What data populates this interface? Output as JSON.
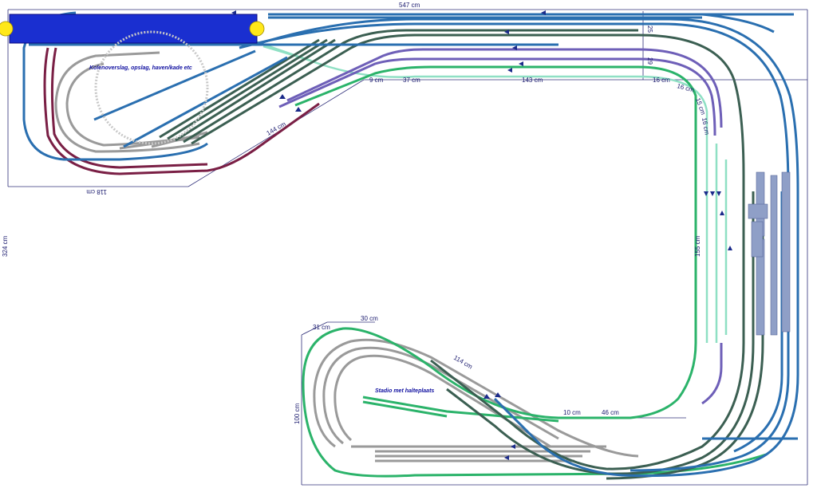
{
  "labels": {
    "coal_area": "Kolenoverslag, opslag, haven/kade etc",
    "stadium": "Stadio met halteplaats"
  },
  "dimensions": {
    "top_width": "547 cm",
    "left_height": "324 cm",
    "d_9": "9 cm",
    "d_37": "37 cm",
    "d_143": "143 cm",
    "d_16": "16 cm",
    "d_144": "144 cm",
    "d_118": "118 cm",
    "d_155": "155 cm",
    "d_100": "100 cm",
    "d_31": "31 cm",
    "d_30": "30 cm",
    "d_114": "114 cm",
    "d_10": "10 cm",
    "d_46": "46 cm",
    "d_25": "25",
    "d_29": "29",
    "d_16b": "16 cm",
    "d_15": "15 cm",
    "d_16c": "16 cm"
  },
  "colors": {
    "blue_track": "#2a6fb0",
    "dark_green_track": "#3b5f52",
    "green_track": "#2bb36a",
    "purple_track": "#6e5fb8",
    "maroon_track": "#7a1f45",
    "gray_track": "#9a9a9a",
    "light_green_track": "#8fe0c4",
    "dim_line": "#30307a",
    "navy_block": "#1a2fd0",
    "yellow_marker": "#ffe81a",
    "platform": "#8f9fc7"
  }
}
